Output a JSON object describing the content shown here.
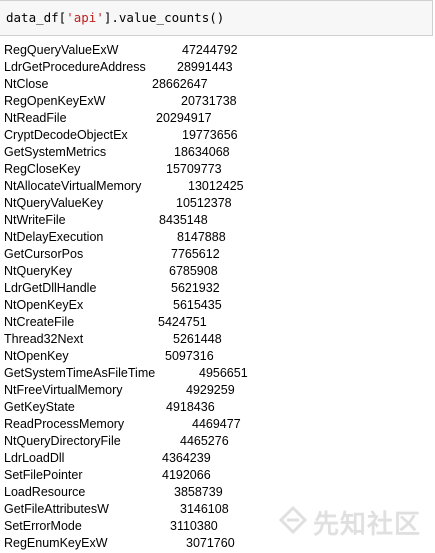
{
  "cell": {
    "code_prefix": "data_df[",
    "code_string": "'api'",
    "code_suffix": "].value_counts()"
  },
  "output": {
    "rows": [
      {
        "name": "RegQueryValueExW",
        "count": "47244792"
      },
      {
        "name": "LdrGetProcedureAddress",
        "count": "28991443"
      },
      {
        "name": "NtClose",
        "count": "28662647"
      },
      {
        "name": "RegOpenKeyExW",
        "count": "20731738"
      },
      {
        "name": "NtReadFile",
        "count": "20294917"
      },
      {
        "name": "CryptDecodeObjectEx",
        "count": "19773656"
      },
      {
        "name": "GetSystemMetrics",
        "count": "18634068"
      },
      {
        "name": "RegCloseKey",
        "count": "15709773"
      },
      {
        "name": "NtAllocateVirtualMemory",
        "count": "13012425"
      },
      {
        "name": "NtQueryValueKey",
        "count": "10512378"
      },
      {
        "name": "NtWriteFile",
        "count": "8435148"
      },
      {
        "name": "NtDelayExecution",
        "count": "8147888"
      },
      {
        "name": "GetCursorPos",
        "count": "7765612"
      },
      {
        "name": "NtQueryKey",
        "count": "6785908"
      },
      {
        "name": "LdrGetDllHandle",
        "count": "5621932"
      },
      {
        "name": "NtOpenKeyEx",
        "count": "5615435"
      },
      {
        "name": "NtCreateFile",
        "count": "5424751"
      },
      {
        "name": "Thread32Next",
        "count": "5261448"
      },
      {
        "name": "NtOpenKey",
        "count": "5097316"
      },
      {
        "name": "GetSystemTimeAsFileTime",
        "count": "4956651"
      },
      {
        "name": "NtFreeVirtualMemory",
        "count": "4929259"
      },
      {
        "name": "GetKeyState",
        "count": "4918436"
      },
      {
        "name": "ReadProcessMemory",
        "count": "4469477"
      },
      {
        "name": "NtQueryDirectoryFile",
        "count": "4465276"
      },
      {
        "name": "LdrLoadDll",
        "count": "4364239"
      },
      {
        "name": "SetFilePointer",
        "count": "4192066"
      },
      {
        "name": "LoadResource",
        "count": "3858739"
      },
      {
        "name": "GetFileAttributesW",
        "count": "3146108"
      },
      {
        "name": "SetErrorMode",
        "count": "3110380"
      },
      {
        "name": "RegEnumKeyExW",
        "count": "3071760"
      }
    ]
  },
  "watermark": {
    "text": "先知社区",
    "icon": "xianzhi-logo-icon"
  }
}
